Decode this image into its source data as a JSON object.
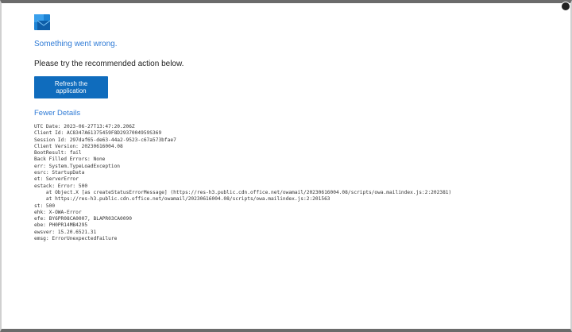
{
  "error_page": {
    "title": "Something went wrong.",
    "subtitle": "Please try the recommended action below.",
    "refresh_label": "Refresh the application",
    "details_toggle_label": "Fewer Details"
  },
  "details_lines": [
    "UTC Date: 2023-06-27T13:47:20.206Z",
    "Client Id: AC8347A61375459F8D2937004959S369",
    "Session Id: 297daf65-de63-44a2-9523-c67a573bfae7",
    "Client Version: 20230616004.08",
    "BootResult: fail",
    "Back Filled Errors: None",
    "err: System.TypeLoadException",
    "esrc: StartupData",
    "et: ServerError",
    "estack: Error: 500",
    "    at Object.X [as createStatusErrorMessage] (https://res-h3.public.cdn.office.net/owamail/20230616004.08/scripts/owa.mailindex.js:2:202381)",
    "    at https://res-h3.public.cdn.office.net/owamail/20230616004.08/scripts/owa.mailindex.js:2:201563",
    "st: 500",
    "ehk: X-OWA-Error",
    "efe: BY6PR08CA0007, BLAPR03CA0090",
    "ebe: PH0PR14MB4295",
    "ewsver: 15.20.6521.31",
    "emsg: ErrorUnexpectedFailure"
  ],
  "colors": {
    "accent": "#0f6cbd",
    "link": "#2f7bd6"
  },
  "icons": {
    "logo": "outlook-logo-icon"
  }
}
